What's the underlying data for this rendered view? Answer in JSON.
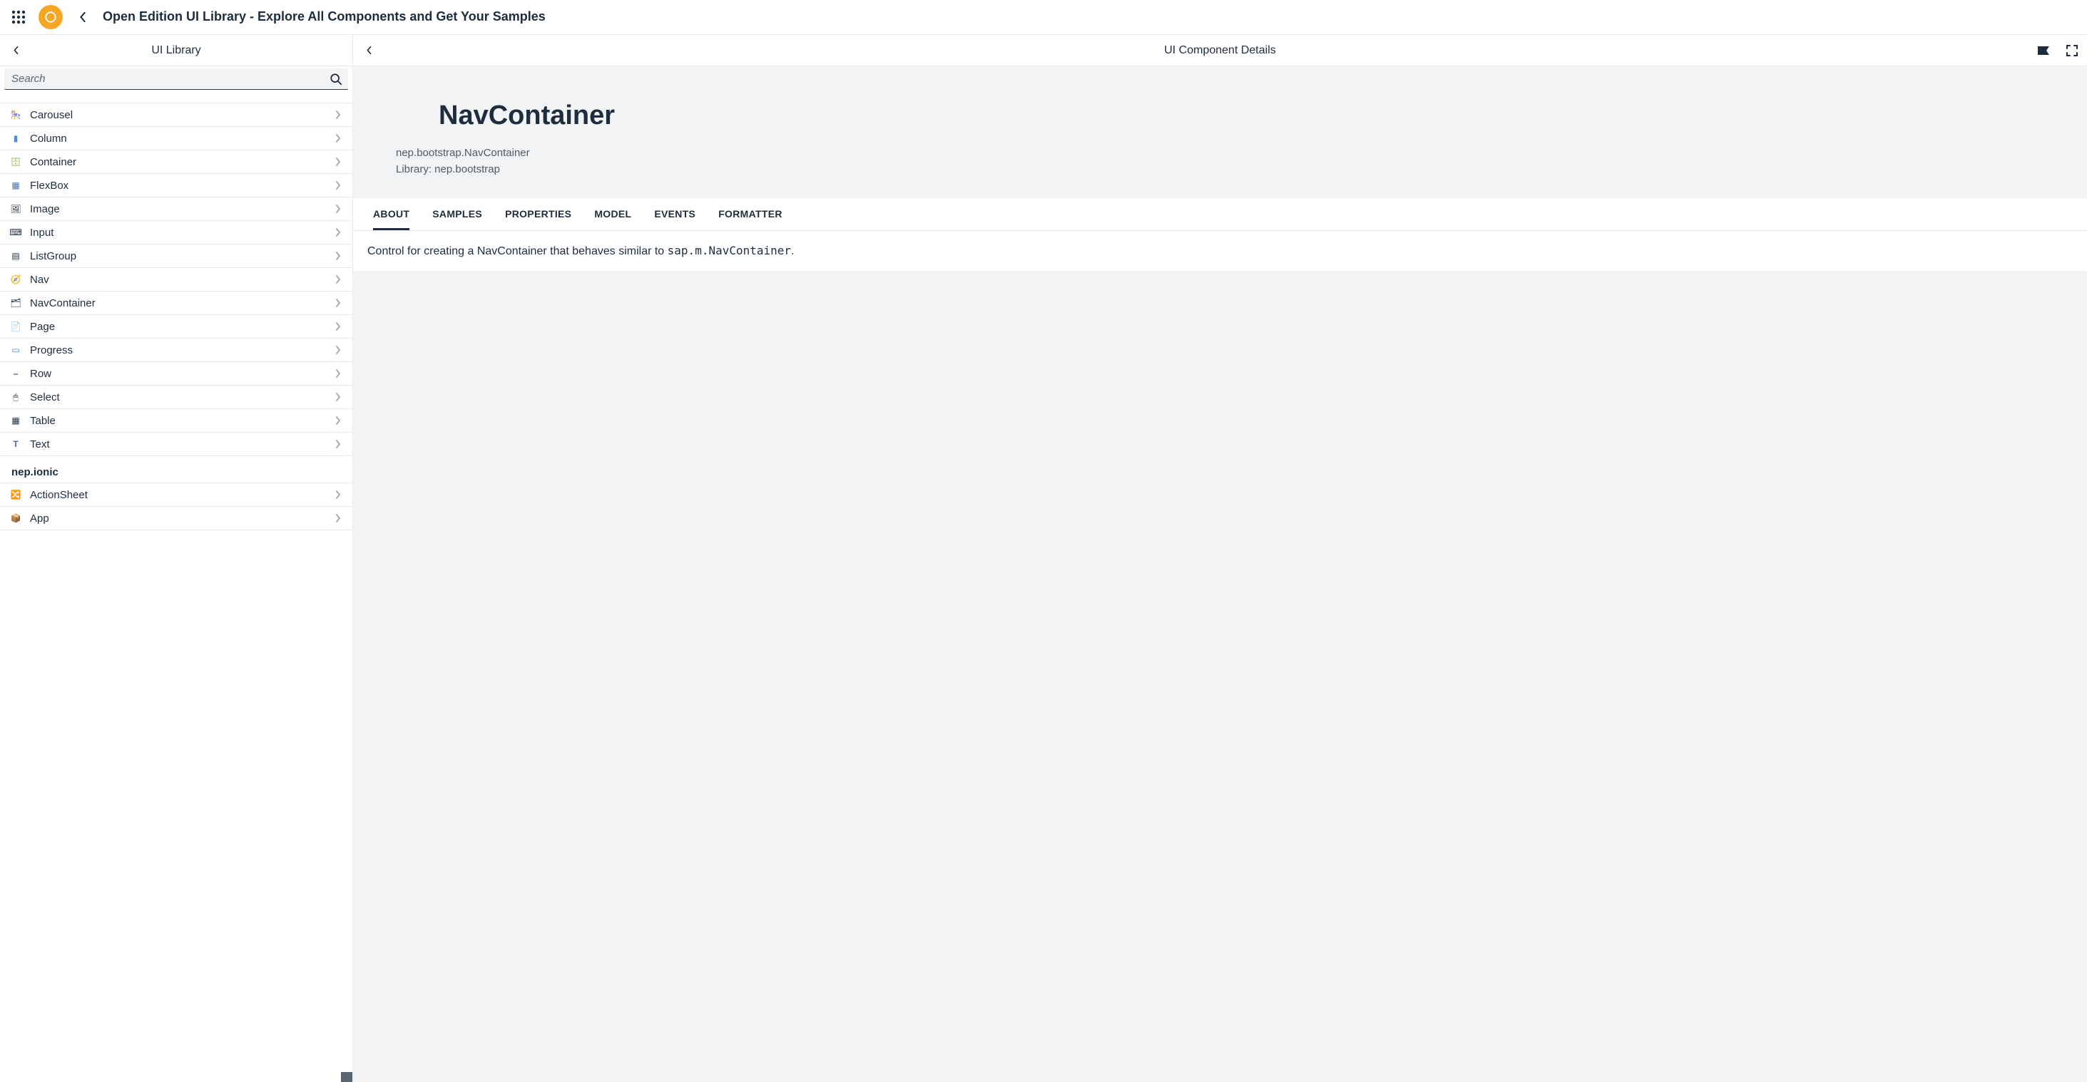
{
  "top": {
    "title": "Open Edition UI Library - Explore All Components and Get Your Samples"
  },
  "sidebar": {
    "title": "UI Library",
    "search_placeholder": "Search",
    "items": [
      {
        "label": "Carousel",
        "icon": "🎠"
      },
      {
        "label": "Column",
        "icon": "▮"
      },
      {
        "label": "Container",
        "icon": "🗄"
      },
      {
        "label": "FlexBox",
        "icon": "▦"
      },
      {
        "label": "Image",
        "icon": "🖼"
      },
      {
        "label": "Input",
        "icon": "⌨"
      },
      {
        "label": "ListGroup",
        "icon": "▤"
      },
      {
        "label": "Nav",
        "icon": "🧭"
      },
      {
        "label": "NavContainer",
        "icon": "🗂"
      },
      {
        "label": "Page",
        "icon": "📄"
      },
      {
        "label": "Progress",
        "icon": "▭"
      },
      {
        "label": "Row",
        "icon": "⎯"
      },
      {
        "label": "Select",
        "icon": "🖱"
      },
      {
        "label": "Table",
        "icon": "▦"
      },
      {
        "label": "Text",
        "icon": "T"
      }
    ],
    "group2": {
      "header": "nep.ionic",
      "items": [
        {
          "label": "ActionSheet",
          "icon": "🔀"
        },
        {
          "label": "App",
          "icon": "📦"
        }
      ]
    }
  },
  "detail": {
    "header_title": "UI Component Details",
    "title": "NavContainer",
    "class_name": "nep.bootstrap.NavContainer",
    "library_label": "Library: nep.bootstrap",
    "tabs": [
      {
        "label": "ABOUT",
        "active": true
      },
      {
        "label": "SAMPLES"
      },
      {
        "label": "PROPERTIES"
      },
      {
        "label": "MODEL"
      },
      {
        "label": "EVENTS"
      },
      {
        "label": "FORMATTER"
      }
    ],
    "about_prefix": "Control for creating a NavContainer that behaves similar to ",
    "about_code": "sap.m.NavContainer",
    "about_suffix": "."
  }
}
